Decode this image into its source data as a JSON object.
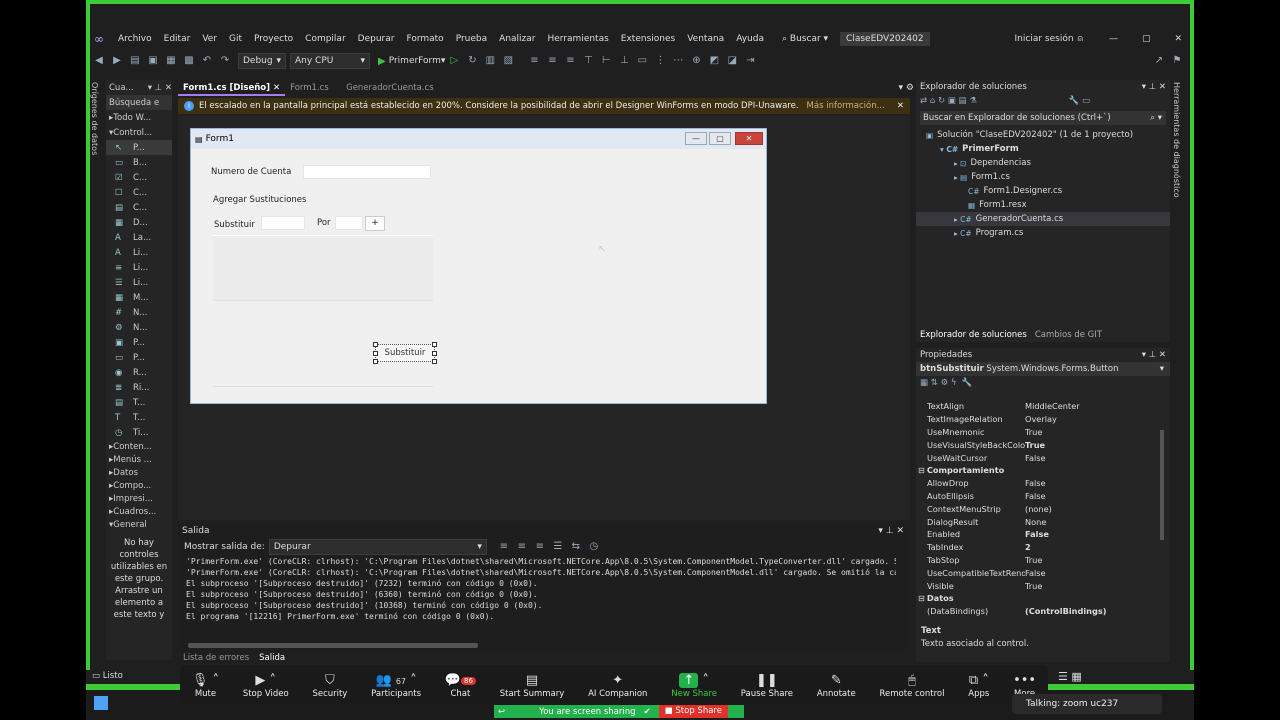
{
  "menu": [
    "Archivo",
    "Editar",
    "Ver",
    "Git",
    "Proyecto",
    "Compilar",
    "Depurar",
    "Formato",
    "Prueba",
    "Analizar",
    "Herramientas",
    "Extensiones",
    "Ventana",
    "Ayuda"
  ],
  "search_label": "Buscar",
  "solution_badge": "ClaseEDV202402",
  "signin": "Iniciar sesión",
  "toolbar": {
    "config": "Debug",
    "platform": "Any CPU",
    "start": "PrimerForm"
  },
  "left_vertical_tab": "Orígenes de datos",
  "toolbox": {
    "title": "Cua...",
    "search": "Búsqueda e",
    "all_group": "Todo W...",
    "controls_group": "Control...",
    "items": [
      "P...",
      "B...",
      "C...",
      "C...",
      "C...",
      "D...",
      "La...",
      "Li...",
      "Li...",
      "Li...",
      "M...",
      "N...",
      "N...",
      "P...",
      "P...",
      "R...",
      "Ri...",
      "T...",
      "T...",
      "Ti..."
    ],
    "groups": [
      "Conten...",
      "Menús ...",
      "Datos",
      "Compo...",
      "Impresi...",
      "Cuadros...",
      "General"
    ],
    "empty_text": "No hay controles utilizables en este grupo. Arrastre un elemento a este texto y"
  },
  "doc_tabs": [
    "Form1.cs [Diseño]",
    "Form1.cs",
    "GeneradorCuenta.cs"
  ],
  "infobar": {
    "text": "El escalado en la pantalla principal está establecido en 200%. Considere la posibilidad de abrir el Designer WinForms en modo DPI-Unaware.",
    "link": "Más información..."
  },
  "form": {
    "title": "Form1",
    "label_cuenta": "Numero de Cuenta",
    "label_agregar": "Agregar Sustituciones",
    "label_sustituir": "Substituir",
    "label_por": "Por",
    "plus_button": "+",
    "sustituir_button": "Substituir"
  },
  "output": {
    "title": "Salida",
    "show_label": "Mostrar salida de:",
    "source": "Depurar",
    "lines": [
      "'PrimerForm.exe' (CoreCLR: clrhost): 'C:\\Program Files\\dotnet\\shared\\Microsoft.NETCore.App\\8.0.5\\System.ComponentModel.TypeConverter.dll' cargado. Se",
      "'PrimerForm.exe' (CoreCLR: clrhost): 'C:\\Program Files\\dotnet\\shared\\Microsoft.NETCore.App\\8.0.5\\System.ComponentModel.dll' cargado. Se omitió la car",
      "El subproceso '[Subproceso destruido]' (7232) terminó con código 0 (0x0).",
      "El subproceso '[Subproceso destruido]' (6360) terminó con código 0 (0x0).",
      "El subproceso '[Subproceso destruido]' (10368) terminó con código 0 (0x0).",
      "El programa '[12216] PrimerForm.exe' terminó con código 0 (0x0)."
    ]
  },
  "bottom_tabs": [
    "Lista de errores",
    "Salida"
  ],
  "solution_explorer": {
    "title": "Explorador de soluciones",
    "search": "Buscar en Explorador de soluciones (Ctrl+`)",
    "tree": [
      {
        "label": "Solución \"ClaseEDV202402\" (1 de 1 proyecto)",
        "level": 0
      },
      {
        "label": "PrimerForm",
        "level": 1
      },
      {
        "label": "Dependencias",
        "level": 2
      },
      {
        "label": "Form1.cs",
        "level": 2
      },
      {
        "label": "Form1.Designer.cs",
        "level": 3
      },
      {
        "label": "Form1.resx",
        "level": 3
      },
      {
        "label": "GeneradorCuenta.cs",
        "level": 2
      },
      {
        "label": "Program.cs",
        "level": 2
      }
    ],
    "tabs": [
      "Explorador de soluciones",
      "Cambios de GIT"
    ]
  },
  "properties": {
    "title": "Propiedades",
    "object": "btnSubstituir",
    "type": "System.Windows.Forms.Button",
    "rows": [
      {
        "n": "TextAlign",
        "v": "MiddleCenter"
      },
      {
        "n": "TextImageRelation",
        "v": "Overlay"
      },
      {
        "n": "UseMnemonic",
        "v": "True"
      },
      {
        "n": "UseVisualStyleBackColor",
        "v": "True"
      },
      {
        "n": "UseWaitCursor",
        "v": "False"
      },
      {
        "cat": "Comportamiento"
      },
      {
        "n": "AllowDrop",
        "v": "False"
      },
      {
        "n": "AutoEllipsis",
        "v": "False"
      },
      {
        "n": "ContextMenuStrip",
        "v": "(none)"
      },
      {
        "n": "DialogResult",
        "v": "None"
      },
      {
        "n": "Enabled",
        "v": "False"
      },
      {
        "n": "TabIndex",
        "v": "2"
      },
      {
        "n": "TabStop",
        "v": "True"
      },
      {
        "n": "UseCompatibleTextRenderin",
        "v": "False"
      },
      {
        "n": "Visible",
        "v": "True"
      },
      {
        "cat": "Datos"
      },
      {
        "n": "(DataBindings)",
        "v": "(ControlBindings)"
      }
    ],
    "desc_title": "Text",
    "desc_text": "Texto asociado al control."
  },
  "right_vertical_tab": "Herramientas de diagnóstico",
  "status": "Listo",
  "zoom": {
    "participants_count": "67",
    "chat_badge": "86",
    "buttons": [
      "Mute",
      "Stop Video",
      "Security",
      "Participants",
      "Chat",
      "Start Summary",
      "AI Companion",
      "New Share",
      "Pause Share",
      "Annotate",
      "Remote control",
      "Apps",
      "More"
    ],
    "sharing_text": "You are screen sharing",
    "stop_share": "Stop Share",
    "talking": "Talking: zoom uc237"
  },
  "colors": {
    "accent": "#a67cf2",
    "zoom_green": "#3fcb39",
    "stop_red": "#e0312b"
  }
}
